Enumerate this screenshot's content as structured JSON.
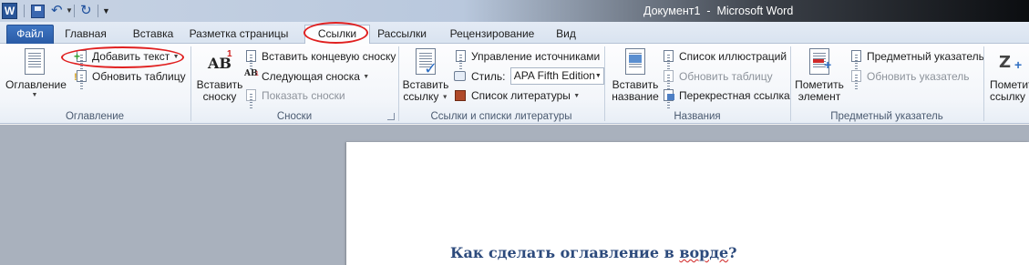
{
  "window": {
    "title": "Документ1  -  Microsoft Word",
    "app_icon_letter": "W"
  },
  "quick_access": {
    "icons": [
      "word-logo-icon",
      "save-icon",
      "undo-icon",
      "redo-icon",
      "customize-qat-icon"
    ]
  },
  "tabs": [
    {
      "label": "Файл",
      "id": "file"
    },
    {
      "label": "Главная",
      "id": "home"
    },
    {
      "label": "Вставка",
      "id": "insert"
    },
    {
      "label": "Разметка страницы",
      "id": "layout"
    },
    {
      "label": "Ссылки",
      "id": "references",
      "active": true
    },
    {
      "label": "Рассылки",
      "id": "mailings"
    },
    {
      "label": "Рецензирование",
      "id": "review"
    },
    {
      "label": "Вид",
      "id": "view"
    }
  ],
  "ribbon": {
    "toc": {
      "label": "Оглавление",
      "big_button": "Оглавление",
      "add_text": "Добавить текст",
      "update_table": "Обновить таблицу"
    },
    "footnotes": {
      "label": "Сноски",
      "insert_footnote": [
        "Вставить",
        "сноску"
      ],
      "insert_endnote": "Вставить концевую сноску",
      "next_footnote": "Следующая сноска",
      "show_notes": "Показать сноски",
      "icon_text": "AB",
      "icon_sup": "1"
    },
    "citations": {
      "label": "Ссылки и списки литературы",
      "insert_citation": [
        "Вставить",
        "ссылку"
      ],
      "manage_sources": "Управление источниками",
      "style_label": "Стиль:",
      "style_value": "APA Fifth Edition",
      "bibliography": "Список литературы"
    },
    "captions": {
      "label": "Названия",
      "insert_caption": [
        "Вставить",
        "название"
      ],
      "insert_table_figures": "Список иллюстраций",
      "update_table": "Обновить таблицу",
      "cross_reference": "Перекрестная ссылка"
    },
    "index": {
      "label": "Предметный указатель",
      "mark_entry": [
        "Пометить",
        "элемент"
      ],
      "insert_index": "Предметный указатель",
      "update_index": "Обновить указатель"
    },
    "table_authorities": {
      "mark_citation": [
        "Пометить",
        "ссылку"
      ]
    }
  },
  "document": {
    "heading_plain": "Как сделать оглавление в ",
    "heading_misspelled": "ворде",
    "heading_end": "?"
  },
  "colors": {
    "accent": "#2a5ba6",
    "annotation": "#e02020",
    "heading": "#2c4a7c"
  }
}
